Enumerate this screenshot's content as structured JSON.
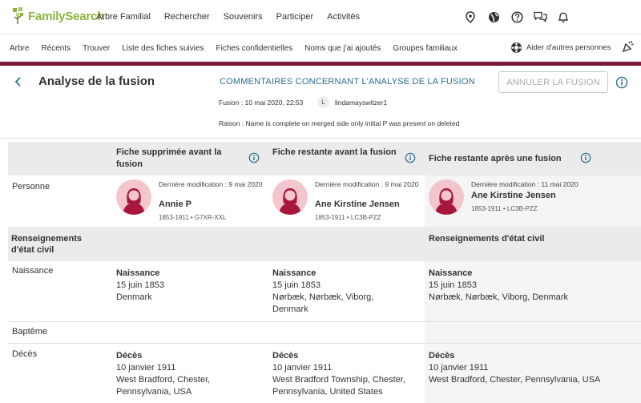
{
  "header": {
    "logo": "FamilySearch",
    "nav": [
      "Arbre Familial",
      "Rechercher",
      "Souvenirs",
      "Participer",
      "Activités"
    ],
    "icons": [
      "location-icon",
      "globe-icon",
      "help-icon",
      "chat-icon",
      "bell-icon"
    ]
  },
  "subnav": {
    "items": [
      "Arbre",
      "Récents",
      "Trouver",
      "Liste des fiches suivies",
      "Fiches confidentielles",
      "Noms que j'ai ajoutés",
      "Groupes familiaux"
    ],
    "helpers": "Aider d'autres personnes"
  },
  "page": {
    "title": "Analyse de la fusion",
    "comments_link": "COMMENTAIRES CONCERNANT L'ANALYSE DE LA FUSION",
    "merge_date": "Fusion : 10 mai 2020, 22:53",
    "user_initial": "L",
    "user_name": "lindamayswitzer1",
    "reason": "Raison : Name is complete on merged side only initial P was present on deleted",
    "unmerge_button": "ANNULER LA FUSION"
  },
  "columns": [
    {
      "title": "Fiche supprimée avant la fusion"
    },
    {
      "title": "Fiche restante avant la fusion"
    },
    {
      "title": "Fiche restante après une fusion"
    }
  ],
  "rows": {
    "person": "Personne",
    "vitals_section": "Renseignements d'état civil",
    "birth": "Naissance",
    "baptism": "Baptême",
    "death": "Décès"
  },
  "persons": [
    {
      "modified": "Dernière modification : 9 mai 2020",
      "name": "Annie P",
      "meta": "1853-1911 • G7XR-XXL"
    },
    {
      "modified": "Dernière modification : 9 mai 2020",
      "name": "Ane Kirstine Jensen",
      "meta": "1853-1911 • LC3B-PZZ"
    },
    {
      "modified": "Dernière modification : 11 mai 2020",
      "name": "Ane Kirstine Jensen",
      "meta": "1853-1911 • LC3B-PZZ"
    }
  ],
  "vitals_col3_heading": "Renseignements d'état civil",
  "births": [
    {
      "type": "Naissance",
      "date": "15 juin 1853",
      "place": "Denmark"
    },
    {
      "type": "Naissance",
      "date": "15 juin 1853",
      "place": "Nørbæk, Nørbæk, Viborg, Denmark"
    },
    {
      "type": "Naissance",
      "date": "15 juin 1853",
      "place": "Nørbæk, Nørbæk, Viborg, Denmark"
    }
  ],
  "deaths": [
    {
      "type": "Décès",
      "date": "10 janvier 1911",
      "place": "West Bradford, Chester, Pennsylvania, USA"
    },
    {
      "type": "Décès",
      "date": "10 janvier 1911",
      "place": "West Bradford Township, Chester, Pennsylvania, United States"
    },
    {
      "type": "Décès",
      "date": "10 janvier 1911",
      "place": "West Bradford, Chester, Pennsylvania, USA"
    }
  ],
  "colors": {
    "brand_line": "#7a1732",
    "link": "#2a6e8f",
    "logo_green": "#8bb43c",
    "avatar_bg": "#f3c5cc",
    "avatar_fg": "#a7173d"
  }
}
